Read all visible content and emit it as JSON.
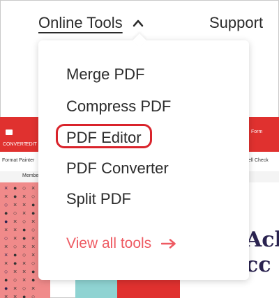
{
  "nav": {
    "online_tools": "Online Tools",
    "support": "Support",
    "chevron_icon": "chevron-up-icon"
  },
  "dropdown": {
    "items": [
      "Merge PDF",
      "Compress PDF",
      "PDF Editor",
      "PDF Converter",
      "Split PDF"
    ],
    "highlighted_item": "PDF Editor",
    "view_all": "View all tools",
    "view_all_icon": "arrow-right-icon"
  },
  "background_app": {
    "toolbar_labels": [
      "CONVERT",
      "EDIT",
      "Format Painter",
      "Member",
      "ell Check"
    ],
    "heading_fragments": [
      "Ack",
      "cc"
    ],
    "form_label": "Form"
  },
  "colors": {
    "accent_red": "#e0312f",
    "highlight_border": "#d9232b",
    "link_coral": "#ee5a62",
    "text_dark": "#2b2b2b"
  }
}
